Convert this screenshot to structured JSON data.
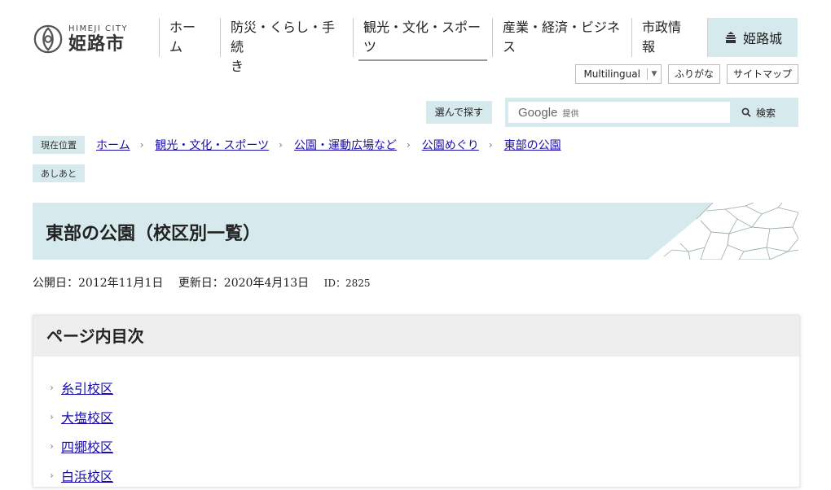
{
  "logo": {
    "en": "HIMEJI CITY",
    "jp": "姫路市"
  },
  "gnav": [
    {
      "line1": "ホー",
      "line2": "ム"
    },
    {
      "line1": "防災・くらし・手続",
      "line2": "き"
    },
    {
      "line1": "観光・文化・スポー",
      "line2": "ツ"
    },
    {
      "line1": "産業・経済・ビジネ",
      "line2": "ス"
    },
    {
      "line1": "市政情",
      "line2": "報"
    }
  ],
  "castle_label": "姫路城",
  "util": {
    "multilingual": "Multilingual",
    "furigana": "ふりがな",
    "sitemap": "サイトマップ"
  },
  "search": {
    "choose": "選んで探す",
    "google": "Google",
    "provided": "提供",
    "button": "検索"
  },
  "breadcrumb": {
    "here": "現在位置",
    "items": [
      "ホーム",
      "観光・文化・スポーツ",
      "公園・運動広場など",
      "公園めぐり",
      "東部の公園"
    ],
    "footprints": "あしあと"
  },
  "page": {
    "title": "東部の公園（校区別一覧）",
    "published": "公開日：2012年11月1日",
    "updated": "更新日：2020年4月13日",
    "id": "ID：2825"
  },
  "toc": {
    "heading": "ページ内目次",
    "items": [
      "糸引校区",
      "大塩校区",
      "四郷校区",
      "白浜校区"
    ]
  },
  "colors": {
    "accent": "#d6e9ed",
    "link": "#1a0dab"
  }
}
